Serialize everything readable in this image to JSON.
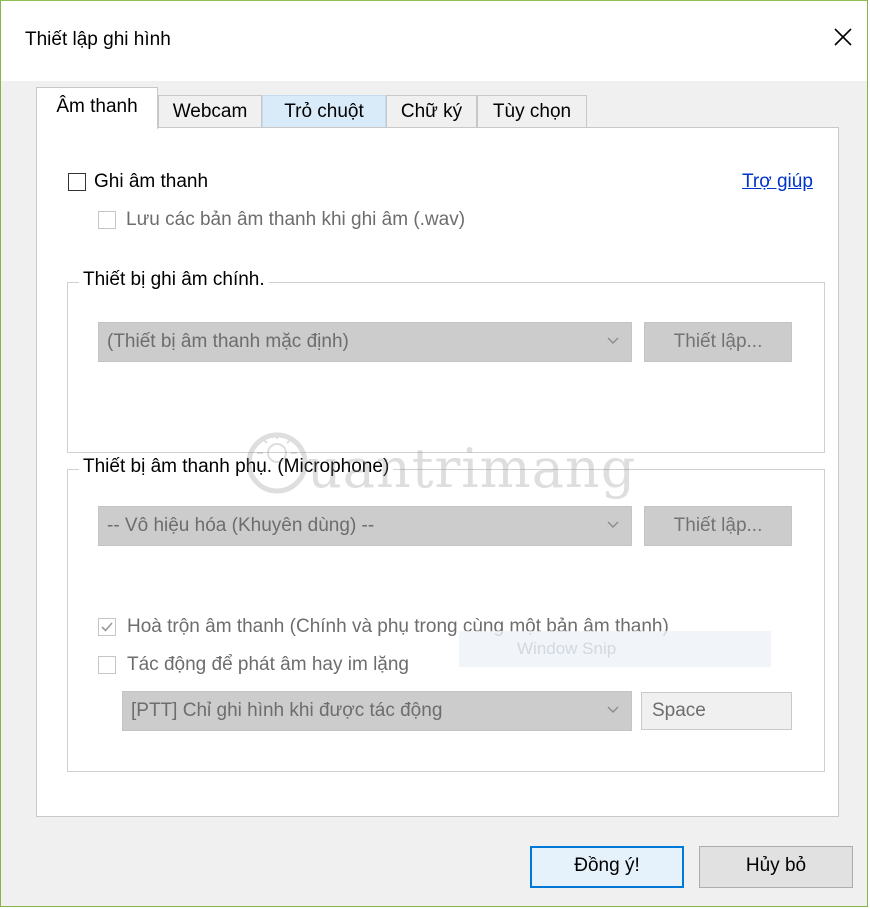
{
  "window": {
    "title": "Thiết lập ghi hình",
    "close_glyph": "✕"
  },
  "tabs": [
    {
      "label": "Âm thanh",
      "active": true
    },
    {
      "label": "Webcam",
      "active": false
    },
    {
      "label": "Trỏ chuột",
      "active": false
    },
    {
      "label": "Chữ ký",
      "active": false
    },
    {
      "label": "Tùy chọn",
      "active": false
    }
  ],
  "audio": {
    "record_audio": {
      "label": "Ghi âm thanh",
      "checked": false
    },
    "help_link": "Trợ giúp",
    "save_wav": {
      "label": "Lưu các bản âm thanh khi ghi âm (.wav)",
      "checked": false,
      "enabled": false
    },
    "primary_device": {
      "group_title": "Thiết bị ghi âm chính.",
      "selected": "(Thiết bị âm thanh mặc định)",
      "setup_button": "Thiết lập..."
    },
    "secondary_device": {
      "group_title": "Thiết bị âm thanh phụ. (Microphone)",
      "selected": "-- Vô hiệu hóa (Khuyên dùng) --",
      "setup_button": "Thiết lập...",
      "mix_audio": {
        "label": "Hoà trộn âm thanh (Chính và phụ trong cùng một bản âm thanh)",
        "checked": true,
        "enabled": false
      },
      "push_to_talk": {
        "label": "Tác động để phát âm hay im lặng",
        "checked": false,
        "enabled": false
      },
      "ptt_mode": "[PTT] Chỉ ghi hình khi được tác động",
      "hotkey": "Space"
    }
  },
  "overlay": {
    "window_snip": "Window Snip",
    "watermark": "uantrimang"
  },
  "footer": {
    "ok_button": "Đồng ý!",
    "cancel_button": "Hủy bỏ"
  },
  "colors": {
    "window_border": "#86b34a",
    "link": "#0033cc",
    "default_button_border": "#0078d7",
    "tab_hover": "#d9ebf9"
  }
}
